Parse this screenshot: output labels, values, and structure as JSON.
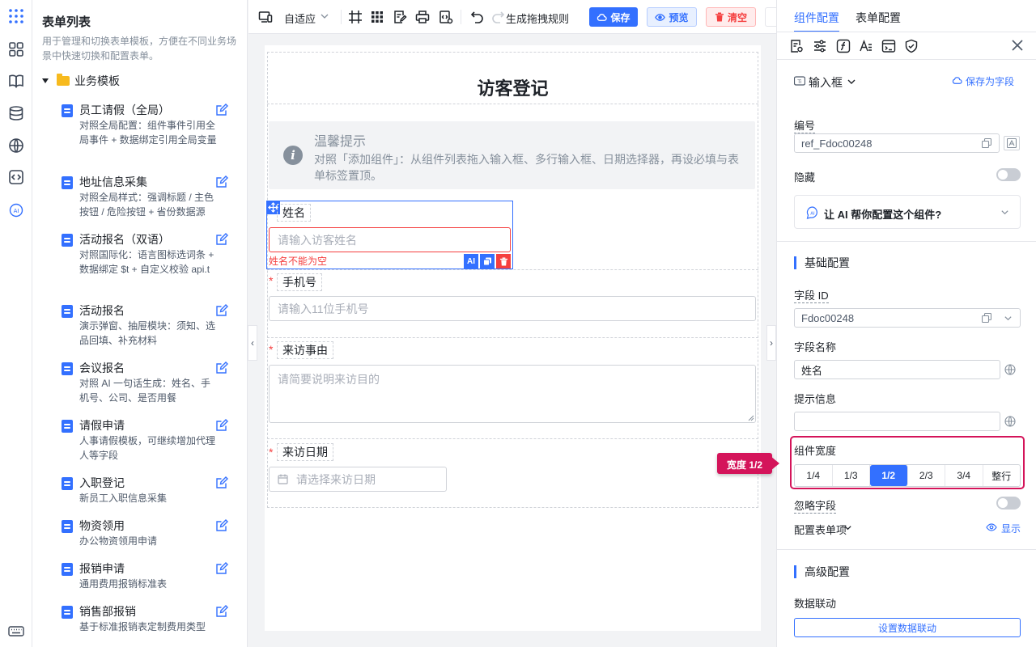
{
  "rail": {
    "icons": [
      "grid-dots-icon",
      "apps-icon",
      "book-icon",
      "database-icon",
      "globe-icon",
      "code-icon",
      "ai-icon",
      "keyboard-icon"
    ]
  },
  "sidebar": {
    "title": "表单列表",
    "description": "用于管理和切换表单模板，方便在不同业务场景中快速切换和配置表单。",
    "group": "业务模板",
    "items": [
      {
        "title": "员工请假（全局）",
        "desc": "对照全局配置：组件事件引用全局事件 + 数据绑定引用全局变量"
      },
      {
        "title": "地址信息采集",
        "desc": "对照全局样式：强调标题 / 主色按钮 / 危险按钮 + 省份数据源"
      },
      {
        "title": "活动报名（双语）",
        "desc": "对照国际化：语言图标选词条 + 数据绑定 $t + 自定义校验 api.t"
      },
      {
        "title": "活动报名",
        "desc": "演示弹窗、抽屉模块：须知、选品回填、补充材料"
      },
      {
        "title": "会议报名",
        "desc": "对照 AI 一句话生成：姓名、手机号、公司、是否用餐"
      },
      {
        "title": "请假申请",
        "desc": "人事请假模板，可继续增加代理人等字段"
      },
      {
        "title": "入职登记",
        "desc": "新员工入职信息采集"
      },
      {
        "title": "物资领用",
        "desc": "办公物资领用申请"
      },
      {
        "title": "报销申请",
        "desc": "通用费用报销标准表"
      },
      {
        "title": "销售部报销",
        "desc": "基于标准报销表定制费用类型"
      }
    ]
  },
  "toolbar": {
    "zoom": "自适应",
    "generate_rules": "生成拖拽规则",
    "save": "保存",
    "preview": "预览",
    "clear": "清空"
  },
  "form": {
    "title": "访客登记",
    "notice_title": "温馨提示",
    "notice_text": "对照「添加组件」：从组件列表拖入输入框、多行输入框、日期选择器，再设必填与表单标签置顶。",
    "name_label": "姓名",
    "name_placeholder": "请输入访客姓名",
    "name_error": "姓名不能为空",
    "phone_label": "手机号",
    "phone_placeholder": "请输入11位手机号",
    "reason_label": "来访事由",
    "reason_placeholder": "请简要说明来访目的",
    "date_label": "来访日期",
    "date_placeholder": "请选择来访日期",
    "required_mark": "*",
    "ai_badge": "AI"
  },
  "panel": {
    "tab_component": "组件配置",
    "tab_form": "表单配置",
    "component_type": "输入框",
    "save_as_field": "保存为字段",
    "code_label": "编号",
    "code_value": "ref_Fdoc00248",
    "hidden_label": "隐藏",
    "ai_prompt": "让 AI 帮你配置这个组件?",
    "basic_section": "基础配置",
    "field_id_label": "字段 ID",
    "field_id_value": "Fdoc00248",
    "field_name_label": "字段名称",
    "field_name_value": "姓名",
    "hint_label": "提示信息",
    "hint_value": "",
    "width_label": "组件宽度",
    "width_tooltip": "宽度 1/2",
    "width_options": [
      "1/4",
      "1/3",
      "1/2",
      "2/3",
      "3/4",
      "整行"
    ],
    "width_selected": "1/2",
    "ignore_label": "忽略字段",
    "form_items_label": "配置表单项",
    "show_label": "显示",
    "advanced_section": "高级配置",
    "linkage_label": "数据联动",
    "linkage_button": "设置数据联动",
    "accent": "#3370ff",
    "highlight": "#d4145a"
  }
}
